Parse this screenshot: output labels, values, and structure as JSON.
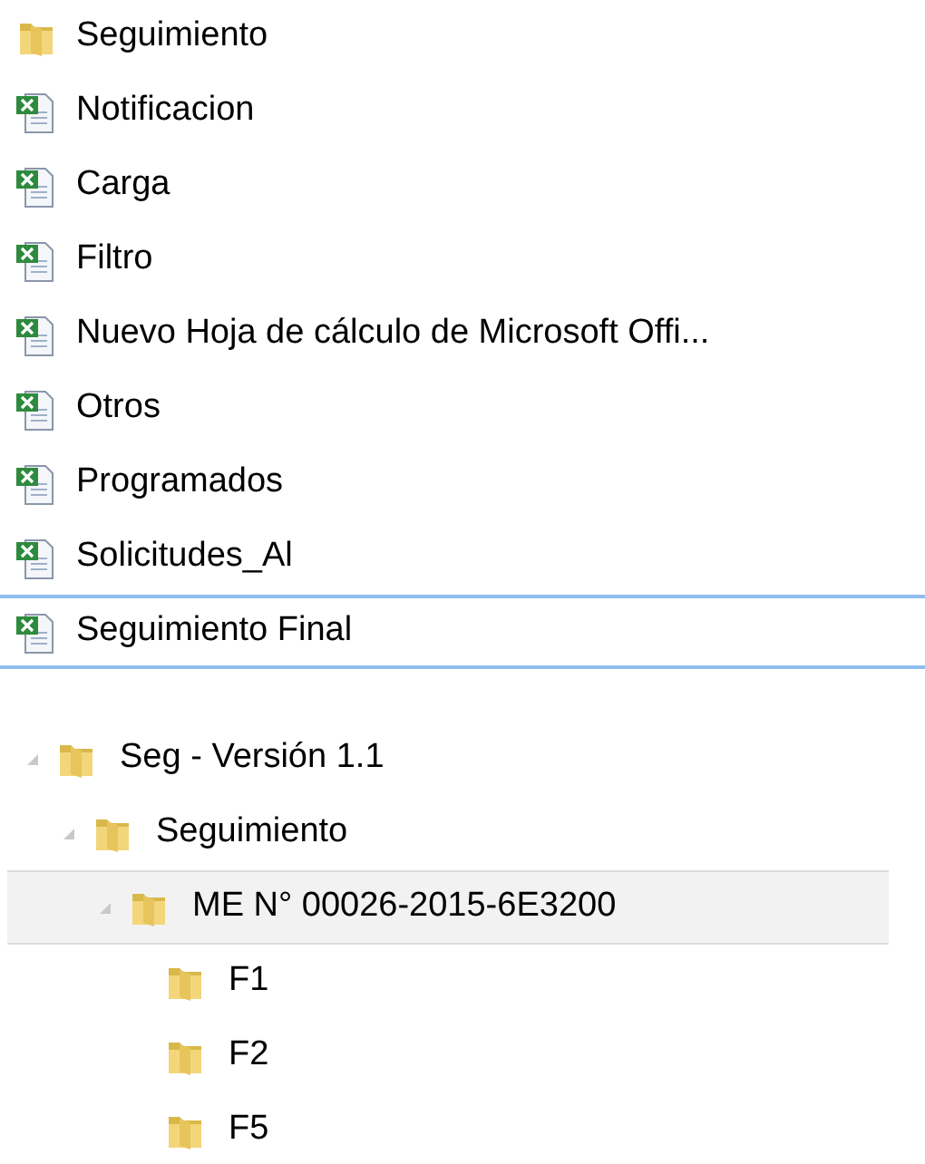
{
  "files": [
    {
      "name": "Seguimiento",
      "kind": "folder",
      "selected": false
    },
    {
      "name": "Notificacion",
      "kind": "excel",
      "selected": false
    },
    {
      "name": "Carga",
      "kind": "excel",
      "selected": false
    },
    {
      "name": "Filtro",
      "kind": "excel",
      "selected": false
    },
    {
      "name": "Nuevo Hoja de cálculo de Microsoft Offi...",
      "kind": "excel",
      "selected": false
    },
    {
      "name": "Otros",
      "kind": "excel",
      "selected": false
    },
    {
      "name": "Programados",
      "kind": "excel",
      "selected": false
    },
    {
      "name": "Solicitudes_Al",
      "kind": "excel",
      "selected": false
    },
    {
      "name": "Seguimiento Final",
      "kind": "excel",
      "selected": true
    }
  ],
  "tree": [
    {
      "name": "Seg - Versión 1.1",
      "expanded": true,
      "selected": false,
      "children": [
        {
          "name": "Seguimiento",
          "expanded": true,
          "selected": false,
          "children": [
            {
              "name": "ME N° 00026-2015-6E3200",
              "expanded": true,
              "selected": true,
              "children": [
                {
                  "name": "F1",
                  "selected": false
                },
                {
                  "name": "F2",
                  "selected": false
                },
                {
                  "name": "F5",
                  "selected": false
                }
              ]
            }
          ]
        }
      ]
    }
  ]
}
